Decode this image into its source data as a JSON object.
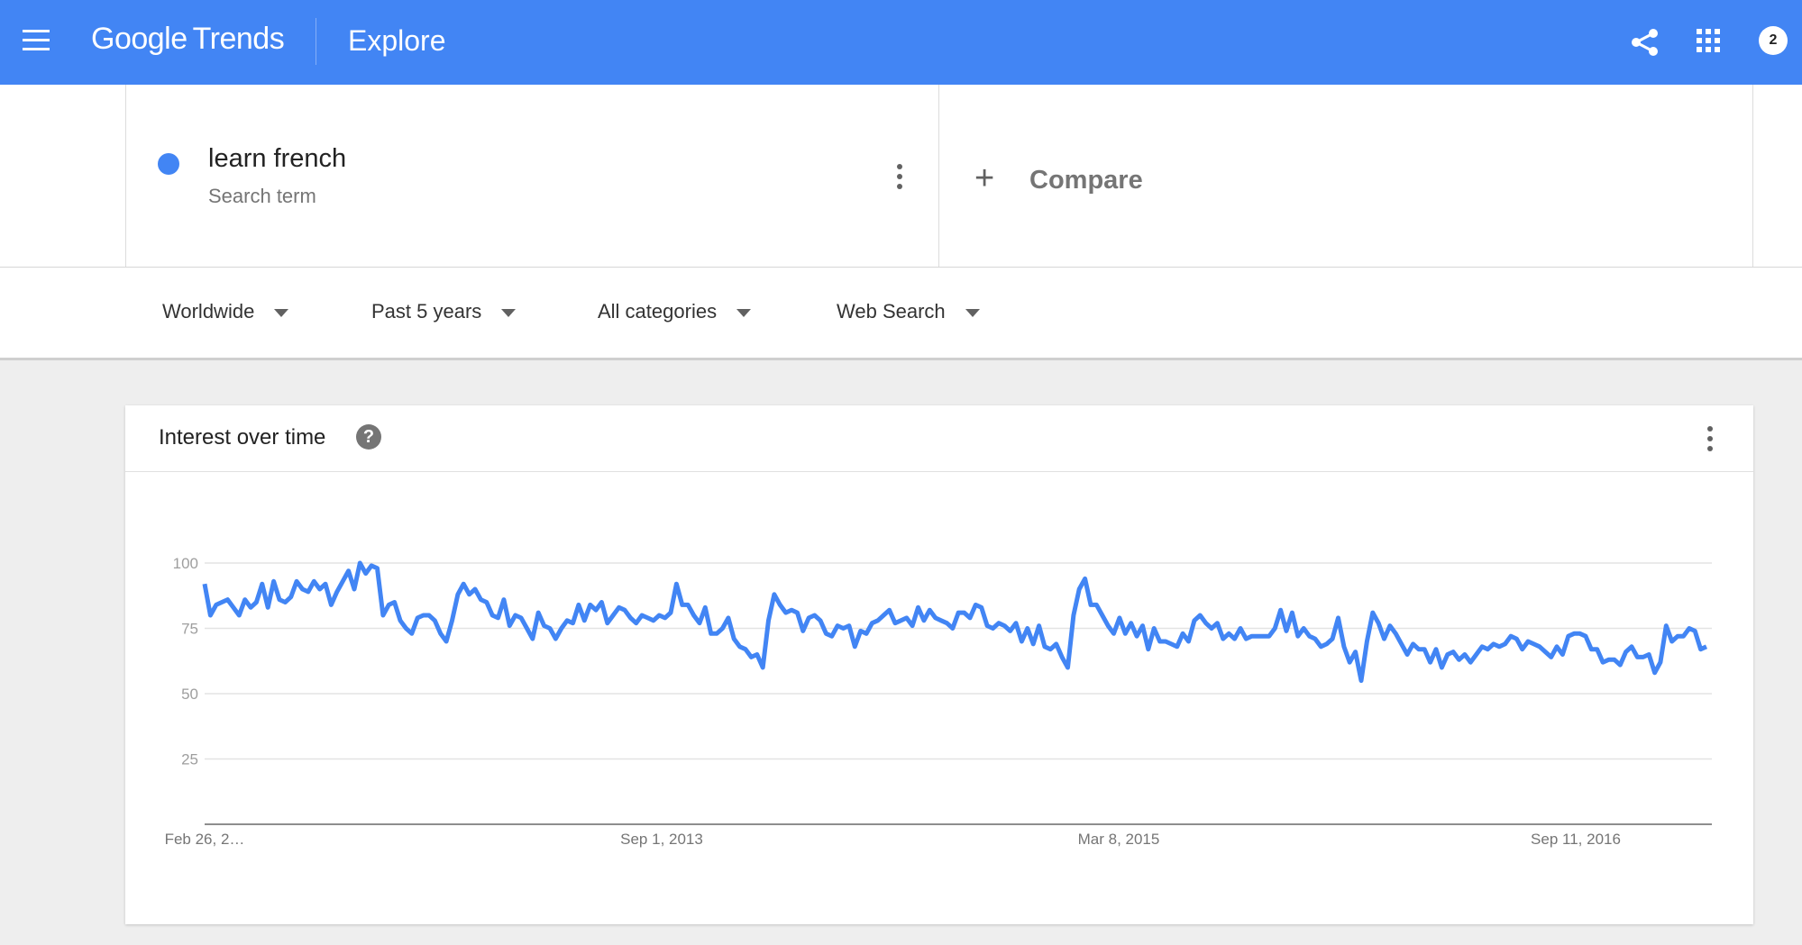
{
  "header": {
    "logo_word1": "Google",
    "logo_word2": "Trends",
    "page_title": "Explore",
    "account_count": "2",
    "icons": [
      "menu-icon",
      "share-icon",
      "apps-icon",
      "account-badge"
    ],
    "color": "#4285f4"
  },
  "term": {
    "name": "learn french",
    "type": "Search term",
    "color": "#4285f4"
  },
  "compare": {
    "plus": "+",
    "label": "Compare"
  },
  "filters": {
    "region": "Worldwide",
    "time": "Past 5 years",
    "category": "All categories",
    "search_type": "Web Search"
  },
  "card": {
    "title": "Interest over time",
    "help": "?"
  },
  "chart_data": {
    "type": "line",
    "title": "",
    "xlabel": "",
    "ylabel": "",
    "ylim": [
      0,
      100
    ],
    "yticks": [
      25,
      50,
      75,
      100
    ],
    "xtick_labels": [
      "Feb 26, 2…",
      "Sep 1, 2013",
      "Mar 8, 2015",
      "Sep 11, 2016"
    ],
    "grid": true,
    "series": [
      {
        "color": "#4285f4",
        "values": [
          92,
          80,
          84,
          85,
          86,
          83,
          80,
          86,
          83,
          85,
          92,
          83,
          93,
          86,
          85,
          87,
          93,
          90,
          89,
          93,
          90,
          92,
          84,
          89,
          93,
          97,
          90,
          100,
          96,
          99,
          98,
          80,
          84,
          85,
          78,
          75,
          73,
          79,
          80,
          80,
          78,
          73,
          70,
          78,
          88,
          92,
          88,
          90,
          86,
          85,
          80,
          79,
          86,
          76,
          80,
          79,
          75,
          71,
          81,
          76,
          75,
          71,
          75,
          78,
          77,
          84,
          78,
          84,
          82,
          85,
          77,
          80,
          83,
          82,
          79,
          77,
          80,
          79,
          78,
          80,
          79,
          81,
          92,
          84,
          84,
          80,
          77,
          83,
          73,
          73,
          75,
          79,
          71,
          68,
          67,
          64,
          65,
          60,
          78,
          88,
          84,
          81,
          82,
          81,
          74,
          79,
          80,
          78,
          73,
          72,
          76,
          75,
          76,
          68,
          74,
          73,
          77,
          78,
          80,
          82,
          77,
          78,
          79,
          76,
          83,
          78,
          82,
          79,
          78,
          77,
          75,
          81,
          81,
          79,
          84,
          83,
          76,
          75,
          77,
          76,
          74,
          77,
          70,
          75,
          69,
          76,
          68,
          67,
          69,
          64,
          60,
          80,
          90,
          94,
          84,
          84,
          80,
          76,
          73,
          79,
          73,
          77,
          72,
          76,
          67,
          75,
          70,
          70,
          69,
          68,
          73,
          70,
          78,
          80,
          77,
          75,
          77,
          71,
          73,
          71,
          75,
          71,
          72,
          72,
          72,
          72,
          75,
          82,
          74,
          81,
          72,
          75,
          72,
          71,
          68,
          69,
          71,
          79,
          68,
          62,
          66,
          55,
          70,
          81,
          77,
          71,
          76,
          73,
          69,
          65,
          69,
          67,
          67,
          62,
          67,
          60,
          65,
          66,
          63,
          65,
          62,
          65,
          68,
          67,
          69,
          68,
          69,
          72,
          71,
          67,
          70,
          69,
          68,
          66,
          64,
          68,
          65,
          72,
          73,
          73,
          72,
          67,
          67,
          62,
          63,
          63,
          61,
          66,
          68,
          64,
          64,
          65,
          58,
          62,
          76,
          70,
          72,
          72,
          75,
          74,
          67,
          68
        ]
      }
    ]
  }
}
